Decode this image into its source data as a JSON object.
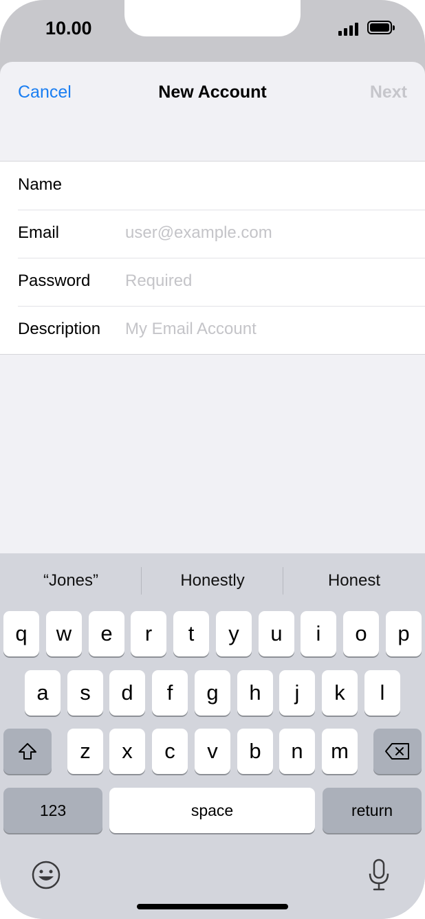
{
  "status_bar": {
    "time": "10.00"
  },
  "nav": {
    "cancel": "Cancel",
    "title": "New Account",
    "next": "Next"
  },
  "form": {
    "rows": [
      {
        "label": "Name",
        "value": ""
      },
      {
        "label": "Email",
        "placeholder": "user@example.com"
      },
      {
        "label": "Password",
        "placeholder": "Required"
      },
      {
        "label": "Description",
        "placeholder": "My Email Account"
      }
    ]
  },
  "keyboard": {
    "suggestions": [
      "“Jones”",
      "Honestly",
      "Honest"
    ],
    "row1": [
      "q",
      "w",
      "e",
      "r",
      "t",
      "y",
      "u",
      "i",
      "o",
      "p"
    ],
    "row2": [
      "a",
      "s",
      "d",
      "f",
      "g",
      "h",
      "j",
      "k",
      "l"
    ],
    "row3": [
      "z",
      "x",
      "c",
      "v",
      "b",
      "n",
      "m"
    ],
    "numbers_label": "123",
    "space_label": "space",
    "return_label": "return",
    "icons": [
      "shift-icon",
      "delete-icon",
      "emoji-icon",
      "microphone-icon"
    ]
  },
  "colors": {
    "accent": "#1a7ef2",
    "disabled": "#c6c6cb",
    "keyboard_bg": "#d3d5dc"
  }
}
